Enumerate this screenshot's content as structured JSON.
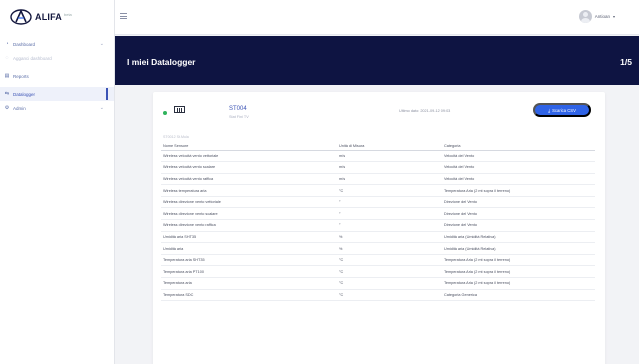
{
  "app": {
    "brand": "ALIFA",
    "brand_sup": "beta"
  },
  "sidebar": {
    "items": [
      {
        "label": "Dashboard",
        "icon": "dashboard-icon",
        "chevron": "⌄"
      },
      {
        "label": "Agganci dashboard",
        "icon": "link-icon"
      },
      {
        "label": "Reports",
        "icon": "chart-icon"
      },
      {
        "label": "Datalogger",
        "icon": "datalogger-icon"
      },
      {
        "label": "Admin",
        "icon": "gear-icon",
        "chevron": "⌄"
      }
    ]
  },
  "topbar": {
    "user_name": "Antioan",
    "caret": "▾"
  },
  "header": {
    "title": "I miei Datalogger",
    "count": "1/5"
  },
  "device": {
    "name": "ST004",
    "subtitle": "Stat Fini TV",
    "last_data": "Ultimo dato: 2021-09-12 09:03",
    "csv_button": "Scarica CSV",
    "serial": "ST0012 St.Mula",
    "status_color": "#2fb35c"
  },
  "table": {
    "headers": [
      "Nome Sensore",
      "Unità di Misura",
      "Categoria"
    ],
    "rows": [
      [
        "Wireless velocità vento vettoriale",
        "m/s",
        "Velocità del Vento"
      ],
      [
        "Wireless velocità vento scalare",
        "m/s",
        "Velocità del Vento"
      ],
      [
        "Wireless velocità vento raffica",
        "m/s",
        "Velocità del Vento"
      ],
      [
        "Wireless temperatura aria",
        "°C",
        "Temperatura Aria (2 mt sopra il terreno)"
      ],
      [
        "Wireless direzione vento vettoriale",
        "°",
        "Direzione del Vento"
      ],
      [
        "Wireless direzione vento scalare",
        "°",
        "Direzione del Vento"
      ],
      [
        "Wireless direzione vento raffica",
        "°",
        "Direzione del Vento"
      ],
      [
        "Umidità aria SHT35",
        "%",
        "Umidità aria (Umidità Relativa)"
      ],
      [
        "Umidità aria",
        "%",
        "Umidità aria (Umidità Relativa)"
      ],
      [
        "Temperatura aria SHT35",
        "°C",
        "Temperatura Aria (2 mt sopra il terreno)"
      ],
      [
        "Temperatura aria PT100",
        "°C",
        "Temperatura Aria (2 mt sopra il terreno)"
      ],
      [
        "Temperatura aria",
        "°C",
        "Temperatura Aria (2 mt sopra il terreno)"
      ],
      [
        "Temperatura SDC",
        "°C",
        "Categoria Generica"
      ]
    ]
  },
  "colors": {
    "band": "#0e1442",
    "accent": "#2f63e6",
    "link": "#3b53b5"
  }
}
